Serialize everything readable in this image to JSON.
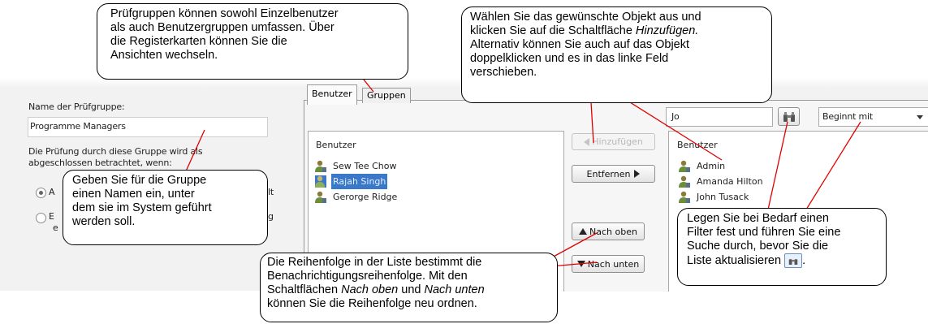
{
  "left_panel": {
    "name_label": "Name der Prüfgruppe:",
    "name_value": "Programme Managers",
    "completion_label_1": "Die Prüfung durch diese Gruppe wird als",
    "completion_label_2": "abgeschlossen betrachtet, wenn:",
    "radio_1_fragment_left": "A",
    "radio_1_fragment_right": "lt",
    "radio_2_fragment_left": "E",
    "radio_2_fragment_right": "g",
    "radio_2_fragment_left_2": "e"
  },
  "tabs": [
    {
      "label": "Benutzer"
    },
    {
      "label": "Gruppen"
    }
  ],
  "search": {
    "value": "Jo",
    "filter_selected": "Beginnt mit"
  },
  "left_list": {
    "header": "Benutzer",
    "items": [
      "Sew Tee Chow",
      "Rajah Singh",
      "Gerorge Ridge"
    ]
  },
  "right_list": {
    "header": "Benutzer",
    "items": [
      "Admin",
      "Amanda Hilton",
      "John Tusack"
    ]
  },
  "buttons": {
    "add": "Hinzufügen",
    "remove": "Entfernen",
    "up": "Nach oben",
    "down": "Nach unten"
  },
  "callouts": {
    "tabs_1": "Prüfgruppen können sowohl Einzelbenutzer",
    "tabs_2": "als auch Benutzergruppen umfassen. Über",
    "tabs_3": "die Registerkarten können Sie die",
    "tabs_4": "Ansichten wechseln.",
    "select_1": "Wählen Sie das gewünschte Objekt aus und",
    "select_2a": "klicken Sie auf die Schaltfläche ",
    "select_2b": "Hinzufügen.",
    "select_3": "Alternativ können Sie auch auf das Objekt",
    "select_4": "doppelklicken und es in das linke Feld",
    "select_5": "verschieben.",
    "name_1": "Geben Sie für die Gruppe",
    "name_2": "einen Namen ein, unter",
    "name_3": "dem sie im System geführt",
    "name_4": "werden soll.",
    "filter_1": "Legen Sie bei Bedarf einen",
    "filter_2": "Filter fest und führen Sie eine",
    "filter_3": "Suche durch, bevor Sie die",
    "filter_4": "Liste aktualisieren",
    "filter_4_end": ".",
    "order_1": "Die Reihenfolge in der Liste bestimmt die",
    "order_2": "Benachrichtigungsreihenfolge. Mit den",
    "order_3a": "Schaltflächen ",
    "order_3b": "Nach oben",
    "order_3c": " und ",
    "order_3d": "Nach unten",
    "order_4": "können Sie die Reihenfolge neu ordnen."
  },
  "colors": {
    "selection": "#3a78c9",
    "dialog_bg": "#f2f2f2",
    "user_icon_green": "#6b8e3a"
  },
  "icons": {
    "search_button": "binoculars-icon",
    "user": "user-icon",
    "dropdown": "chevron-down-icon"
  }
}
